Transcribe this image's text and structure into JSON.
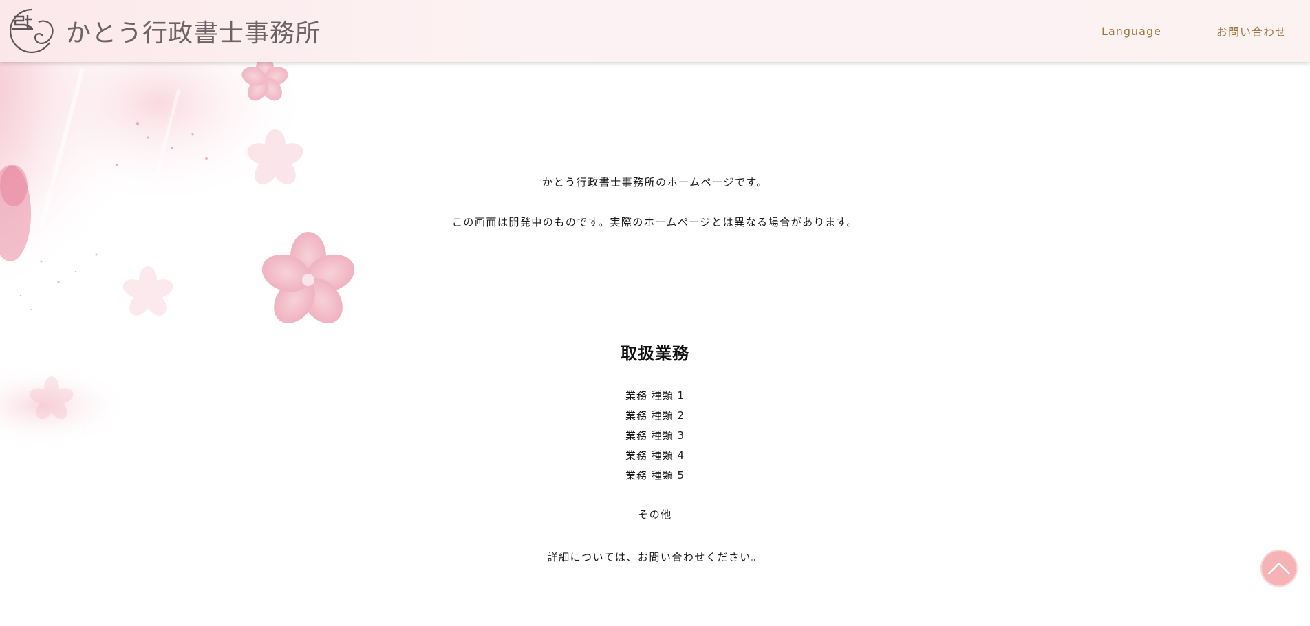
{
  "header": {
    "logo_text": "かとう行政書士事務所",
    "nav": {
      "language_label": "Language",
      "contact_label": "お問い合わせ"
    }
  },
  "intro": {
    "line1": "かとう行政書士事務所のホームページです。",
    "line2": "この画面は開発中のものです。実際のホームページとは異なる場合があります。"
  },
  "services": {
    "title": "取扱業務",
    "items": [
      "業務 種類 1",
      "業務 種類 2",
      "業務 種類 3",
      "業務 種類 4",
      "業務 種類 5"
    ],
    "other": "その他",
    "detail_note": "詳細については、お問い合わせください。"
  },
  "colors": {
    "header_bg": "#fdf1f2",
    "nav_text": "#9c7a3c",
    "logo_text": "#6d6366",
    "blossom_pink": "#f2a9b8",
    "back_to_top_bg": "#f6b3b5"
  },
  "icons": {
    "logo_mark": "logo-emblem-icon",
    "back_to_top": "chevron-up-icon"
  }
}
